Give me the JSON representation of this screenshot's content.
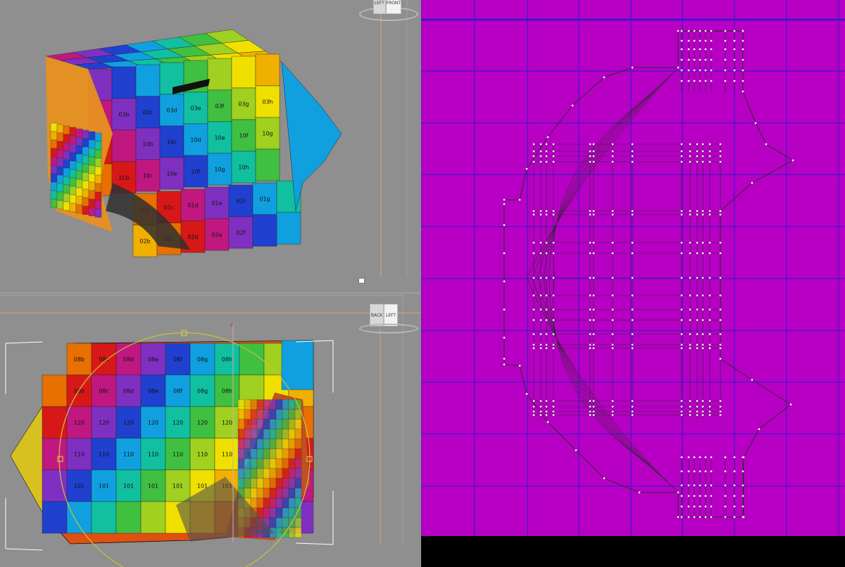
{
  "viewport_top": {
    "viewcube_labels": [
      "LEFT",
      "FRONT"
    ],
    "uv_cell_labels": [
      [
        "",
        "",
        "",
        "",
        "",
        ""
      ],
      [
        "",
        "03b",
        "03c",
        "03d",
        "03e",
        "03f",
        "03g",
        "03h"
      ],
      [
        "",
        "",
        "10b",
        "10c",
        "10d",
        "10e",
        "10f",
        "10g"
      ],
      [
        "",
        "1Cb",
        "10c",
        "10e",
        "10f",
        "10g",
        "10h"
      ],
      [
        "",
        "01b",
        "01c",
        "01d",
        "01e",
        "01f",
        "01g"
      ],
      [
        "",
        "02b",
        "02c",
        "02d",
        "02e",
        "02f"
      ]
    ]
  },
  "viewport_bottom": {
    "viewcube_labels": [
      "BACK",
      "LEFT"
    ],
    "uv_cell_labels": [
      [
        "08b",
        "08c",
        "08d",
        "08e",
        "08f",
        "08g",
        "08h"
      ],
      [
        "120",
        "120",
        "120",
        "120",
        "120",
        "120",
        "120",
        "120"
      ],
      [
        "110",
        "110",
        "110",
        "110",
        "110",
        "110",
        "110",
        "110"
      ],
      [
        "101",
        "101",
        "101",
        "101",
        "101",
        "101",
        "101"
      ]
    ],
    "gizmo_axis_label": "z"
  },
  "uv_editor": {
    "colors": {
      "background": "#b700c4",
      "grid": "#2a1ad0",
      "wire": "#2b2b2b",
      "vertex": "#ffffff",
      "edge_bar": "#000000"
    }
  }
}
